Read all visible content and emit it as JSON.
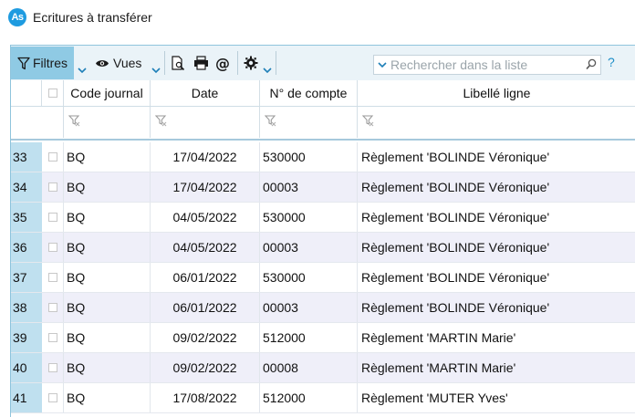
{
  "window": {
    "logo_text": "As",
    "title": "Ecritures à transférer"
  },
  "toolbar": {
    "filtres_label": "Filtres",
    "vues_label": "Vues",
    "search_placeholder": "Rechercher dans la liste",
    "help_label": "?"
  },
  "columns": [
    "Code journal",
    "Date",
    "N° de compte",
    "Libellé ligne"
  ],
  "rows": [
    {
      "num": "33",
      "code": "BQ",
      "date": "17/04/2022",
      "compte": "530000",
      "libelle": "Règlement 'BOLINDE Véronique'"
    },
    {
      "num": "34",
      "code": "BQ",
      "date": "17/04/2022",
      "compte": "00003",
      "libelle": "Règlement 'BOLINDE Véronique'"
    },
    {
      "num": "35",
      "code": "BQ",
      "date": "04/05/2022",
      "compte": "530000",
      "libelle": "Règlement 'BOLINDE Véronique'"
    },
    {
      "num": "36",
      "code": "BQ",
      "date": "04/05/2022",
      "compte": "00003",
      "libelle": "Règlement 'BOLINDE Véronique'"
    },
    {
      "num": "37",
      "code": "BQ",
      "date": "06/01/2022",
      "compte": "530000",
      "libelle": "Règlement 'BOLINDE Véronique'"
    },
    {
      "num": "38",
      "code": "BQ",
      "date": "06/01/2022",
      "compte": "00003",
      "libelle": "Règlement 'BOLINDE Véronique'"
    },
    {
      "num": "39",
      "code": "BQ",
      "date": "09/02/2022",
      "compte": "512000",
      "libelle": "Règlement 'MARTIN Marie'"
    },
    {
      "num": "40",
      "code": "BQ",
      "date": "09/02/2022",
      "compte": "00008",
      "libelle": "Règlement 'MARTIN Marie'"
    },
    {
      "num": "41",
      "code": "BQ",
      "date": "17/08/2022",
      "compte": "512000",
      "libelle": "Règlement 'MUTER Yves'"
    }
  ]
}
